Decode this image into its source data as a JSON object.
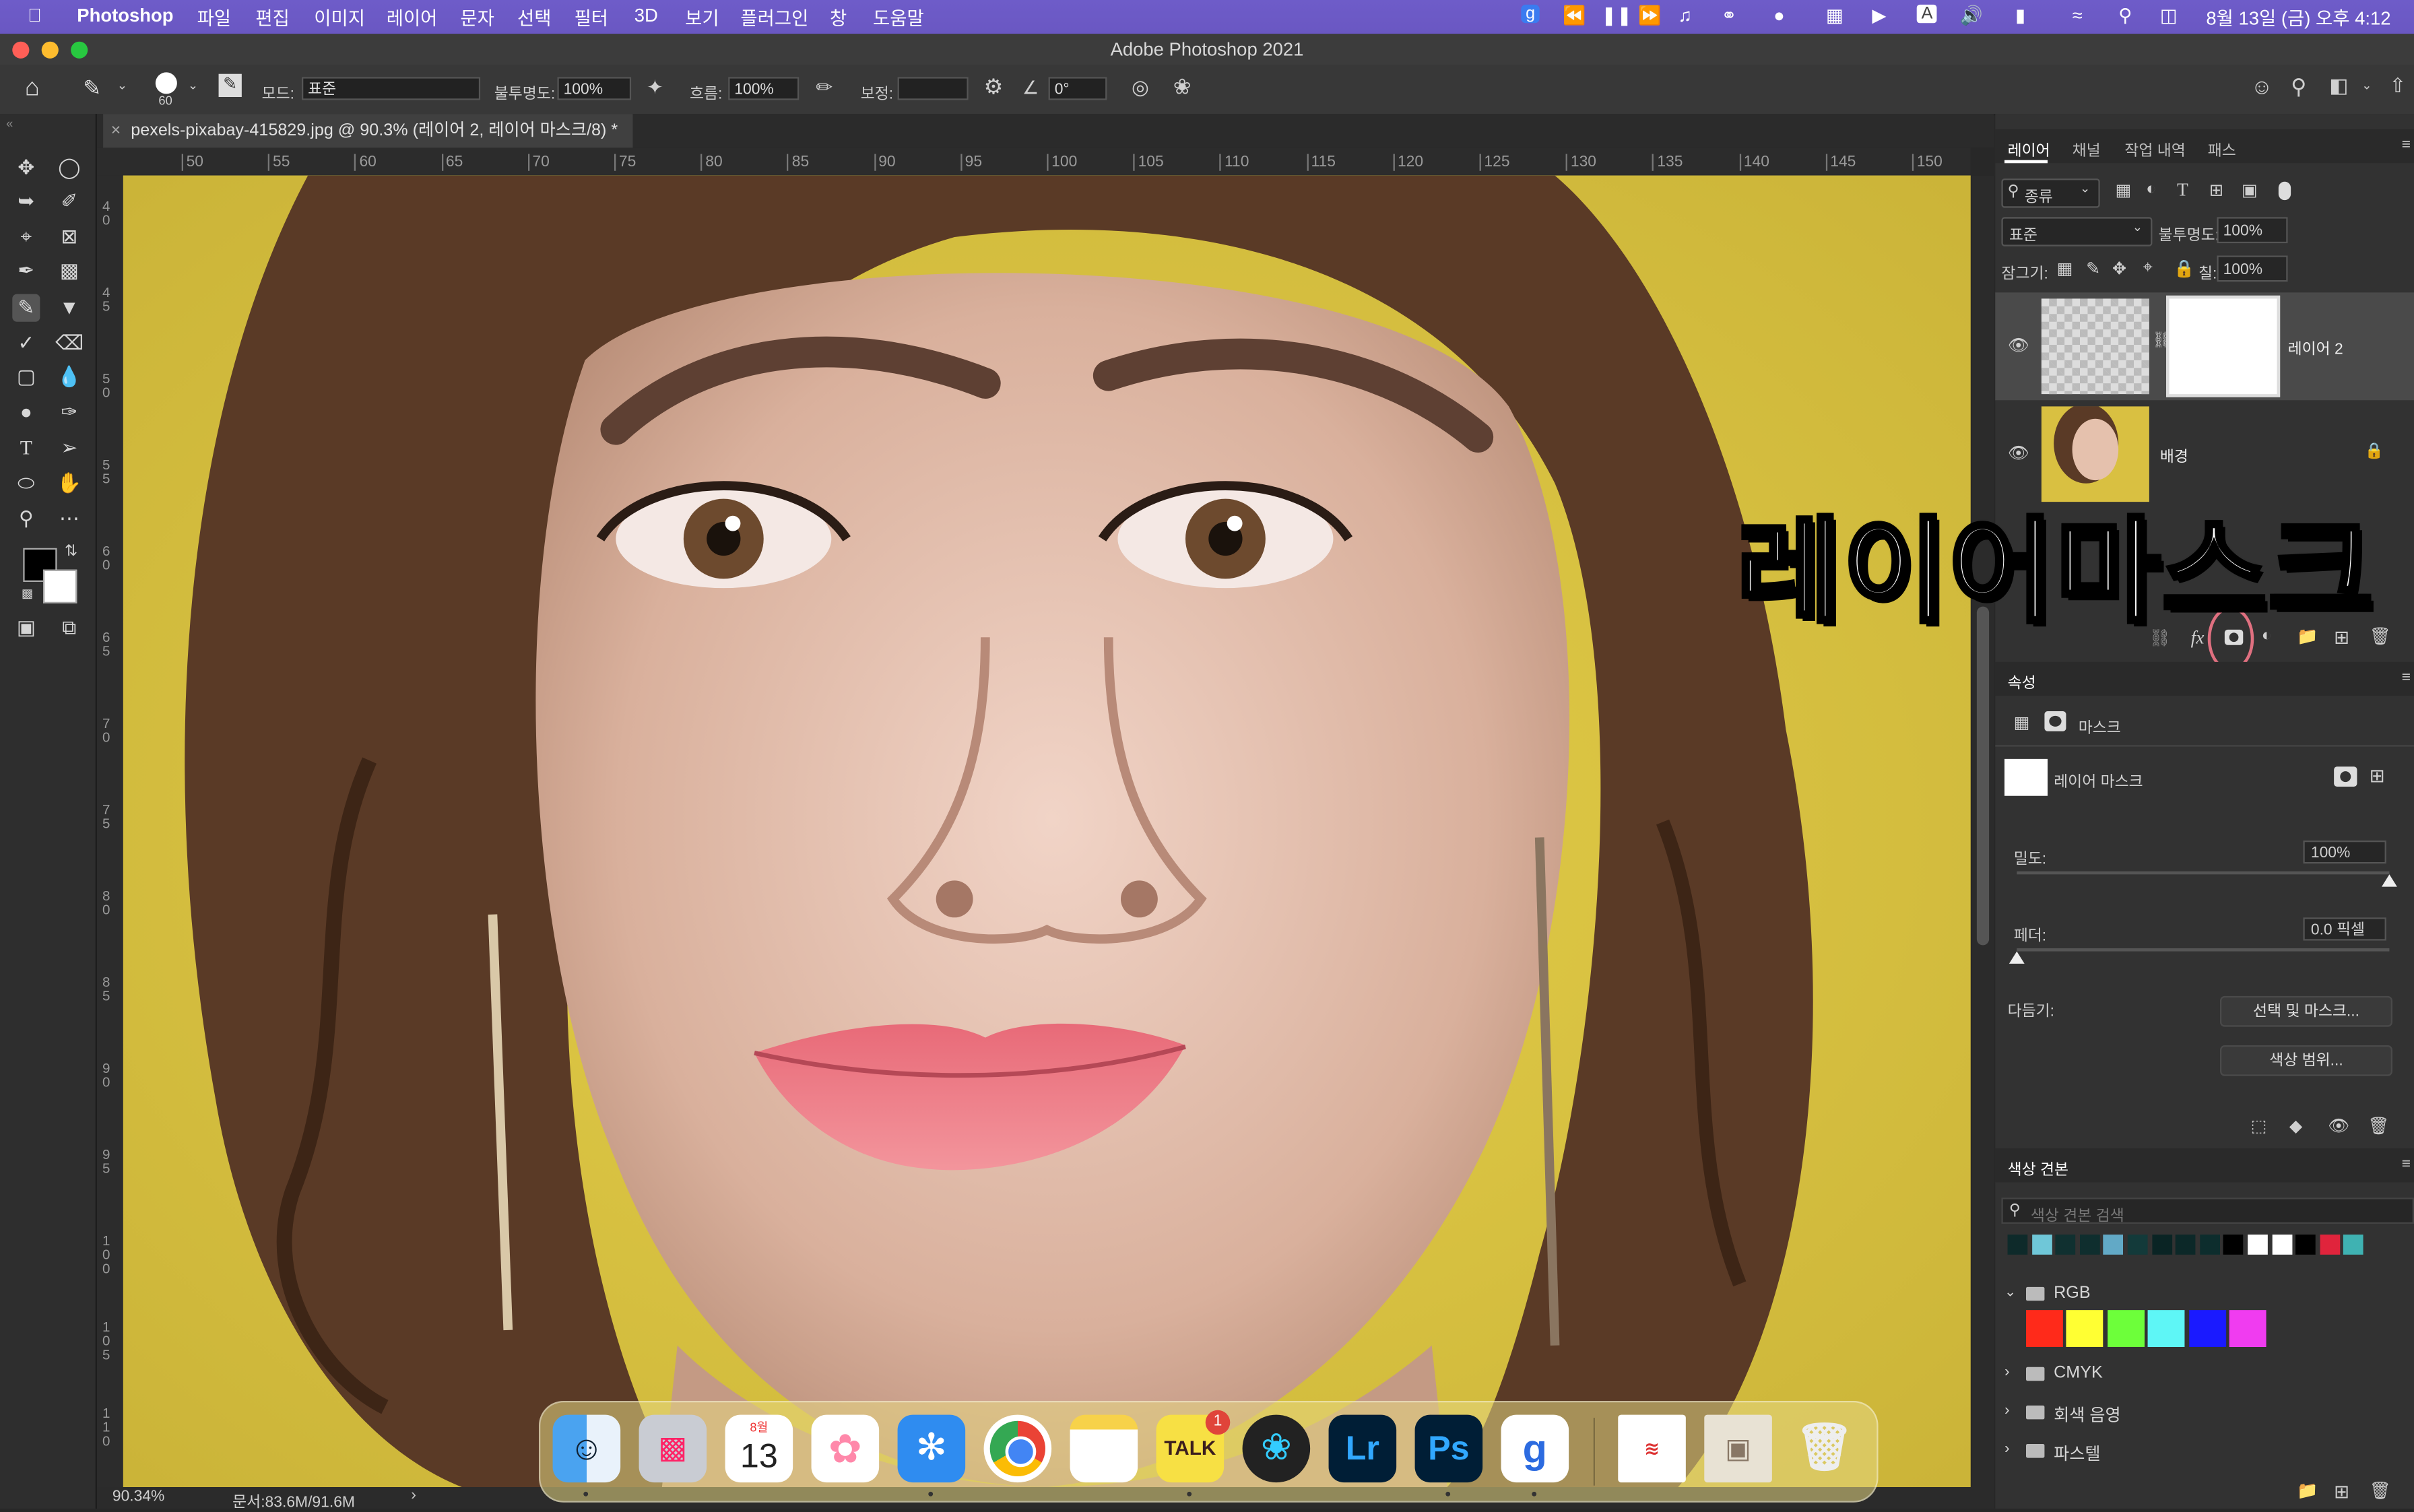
{
  "menubar": {
    "app_name": "Photoshop",
    "items": [
      "파일",
      "편집",
      "이미지",
      "레이어",
      "문자",
      "선택",
      "필터",
      "3D",
      "보기",
      "플러그인",
      "창",
      "도움말"
    ],
    "clock": "8월 13일 (금) 오후 4:12"
  },
  "window": {
    "title": "Adobe Photoshop 2021"
  },
  "options": {
    "brush_size": "60",
    "mode_label": "모드:",
    "mode_value": "표준",
    "opacity_label": "불투명도:",
    "opacity_value": "100%",
    "flow_label": "흐름:",
    "flow_value": "100%",
    "smoothing_label": "보정:",
    "smoothing_value": "",
    "angle_value": "0°"
  },
  "document": {
    "tab_title": "pexels-pixabay-415829.jpg @ 90.3% (레이어 2, 레이어 마스크/8) *",
    "ruler_h": [
      "50",
      "55",
      "60",
      "65",
      "70",
      "75",
      "80",
      "85",
      "90",
      "95",
      "100",
      "105",
      "110",
      "115",
      "120",
      "125",
      "130",
      "135",
      "140",
      "145",
      "150"
    ],
    "ruler_v": [
      "4 0",
      "4 5",
      "5 0",
      "5 5",
      "6 0",
      "6 5",
      "7 0",
      "7 5",
      "8 0",
      "8 5",
      "9 0",
      "9 5",
      "1 0 0",
      "1 0 5",
      "1 1 0"
    ],
    "zoom": "90.34%",
    "doc_size": "문서:83.6M/91.6M"
  },
  "layers_panel": {
    "tabs": [
      "레이어",
      "채널",
      "작업 내역",
      "패스"
    ],
    "filter_label": "종류",
    "blend_mode": "표준",
    "opacity_label": "불투명도:",
    "opacity_value": "100%",
    "lock_label": "잠그기:",
    "fill_label": "칠:",
    "fill_value": "100%",
    "layers": [
      {
        "name": "레이어 2",
        "selected": true
      },
      {
        "name": "배경",
        "selected": false
      }
    ]
  },
  "annotation": {
    "text": "레이어마스크",
    "highlight_color": "#e07080"
  },
  "properties_panel": {
    "title": "속성",
    "mask_label": "마스크",
    "layer_mask_label": "레이어 마스크",
    "density_label": "밀도:",
    "density_value": "100%",
    "density": 1.0,
    "feather_label": "페더:",
    "feather_value": "0.0 픽셀",
    "feather": 0.0,
    "refine_label": "다듬기:",
    "select_mask_button": "선택 및 마스크...",
    "color_range_button": "색상 범위..."
  },
  "swatches_panel": {
    "title": "색상 견본",
    "search_placeholder": "색상 견본 검색",
    "recent": [
      "#0e2a2a",
      "#6fc7d8",
      "#103030",
      "#0f2e2e",
      "#62a9c6",
      "#133a3a",
      "#0a2424",
      "#0c2828",
      "#0d2d2d",
      "#000000",
      "#ffffff",
      "#ffffff",
      "#000000",
      "#e0243c",
      "#3fb2b2"
    ],
    "groups": [
      {
        "name": "RGB",
        "expanded": true,
        "colors": [
          "#ff2a1a",
          "#ffff33",
          "#6dff3a",
          "#5ef6f6",
          "#1a1aff",
          "#f03cf0"
        ]
      },
      {
        "name": "CMYK",
        "expanded": false
      },
      {
        "name": "회색 음영",
        "expanded": false
      },
      {
        "name": "파스텔",
        "expanded": false
      }
    ]
  },
  "dock": {
    "apps": [
      "finder",
      "launchpad",
      "calendar",
      "photos",
      "safari",
      "chrome",
      "notes",
      "kakaotalk",
      "davinci-resolve",
      "lightroom",
      "photoshop",
      "gmarket",
      "textedit",
      "preview",
      "trash"
    ],
    "calendar_month": "8월",
    "calendar_day": "13",
    "kakao_label": "TALK",
    "kakao_badge": "1",
    "lr_label": "Lr",
    "ps_label": "Ps",
    "g_label": "g"
  }
}
